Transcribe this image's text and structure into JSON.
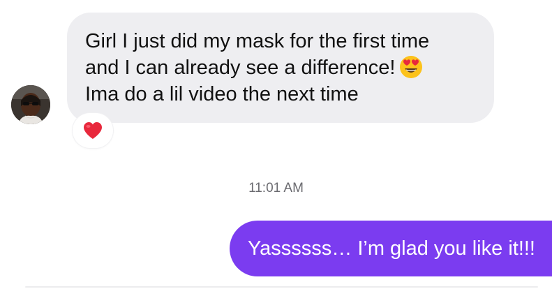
{
  "incoming_message": {
    "lines": [
      "Girl I just did my mask for the first time",
      "and I can already see a difference!",
      "Ima do a lil video the next time"
    ],
    "emoji": "heart-eyes-emoji",
    "reaction": "red-heart-emoji"
  },
  "timestamp": "11:01 AM",
  "outgoing_message": {
    "text": "Yassssss… I’m glad you like it!!!"
  },
  "colors": {
    "incoming_bubble": "#eeeef1",
    "outgoing_bubble": "#7b3cf0",
    "timestamp_text": "#6b6b70"
  }
}
